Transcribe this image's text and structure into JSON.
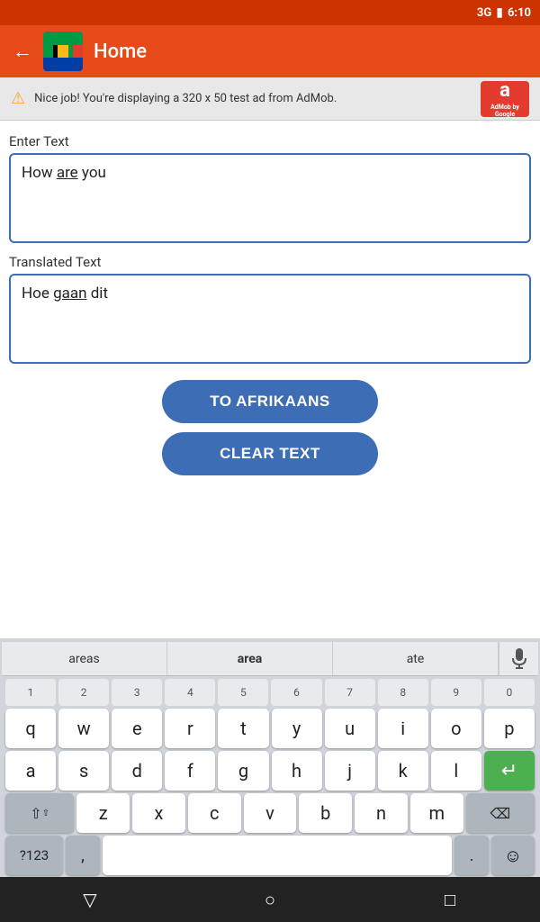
{
  "statusBar": {
    "signal": "3G",
    "battery": "🔋",
    "time": "6:10"
  },
  "appBar": {
    "title": "Home",
    "backLabel": "←"
  },
  "adBanner": {
    "text": "Nice job! You're displaying a 320 x 50 test ad from AdMob.",
    "logoText": "a",
    "logoSub": "AdMob by Google"
  },
  "inputSection": {
    "enterTextLabel": "Enter Text",
    "inputText": "How are you",
    "translatedTextLabel": "Translated Text",
    "translatedText": "Hoe gaan dit"
  },
  "buttons": {
    "toAfrikaansLabel": "TO AFRIKAANS",
    "clearTextLabel": "CLEAR TEXT"
  },
  "suggestions": [
    {
      "text": "areas",
      "bold": false
    },
    {
      "text": "area",
      "bold": true
    },
    {
      "text": "ate",
      "bold": false
    }
  ],
  "keyboard": {
    "numbers": [
      "1",
      "2",
      "3",
      "4",
      "5",
      "6",
      "7",
      "8",
      "9",
      "0"
    ],
    "row1": [
      "q",
      "w",
      "e",
      "r",
      "t",
      "y",
      "u",
      "i",
      "o",
      "p"
    ],
    "row2": [
      "a",
      "s",
      "d",
      "f",
      "g",
      "h",
      "j",
      "k",
      "l"
    ],
    "row3": [
      "z",
      "x",
      "c",
      "v",
      "b",
      "n",
      "m"
    ],
    "shiftIcon": "⇧",
    "backspaceIcon": "⌫",
    "numbersKey": "?123",
    "commaKey": ",",
    "spaceLabel": "",
    "periodKey": ".",
    "enterIcon": "↵",
    "emojiIcon": "☺"
  },
  "navBar": {
    "backIcon": "▽",
    "homeIcon": "○",
    "recentsIcon": "□"
  },
  "colors": {
    "accent": "#e64a19",
    "buttonBlue": "#3d6db5",
    "enterGreen": "#4caf50"
  }
}
